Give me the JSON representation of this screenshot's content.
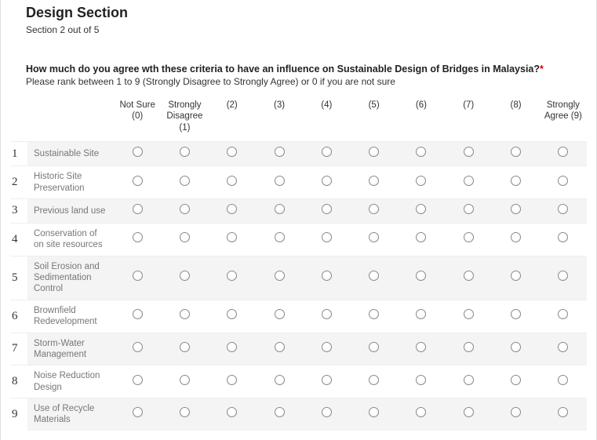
{
  "section": {
    "title": "Design Section",
    "subtitle": "Section 2 out of 5"
  },
  "question": {
    "text": "How much do you agree wth these criteria to have an influence on Sustainable Design of Bridges in Malaysia?",
    "required_mark": "*",
    "instructions": "Please rank between 1 to 9 (Strongly Disagree to Strongly Agree) or 0 if you are not sure"
  },
  "columns": [
    "Not Sure (0)",
    "Strongly Disagree (1)",
    "(2)",
    "(3)",
    "(4)",
    "(5)",
    "(6)",
    "(7)",
    "(8)",
    "Strongly Agree (9)"
  ],
  "rows": [
    {
      "num": "1",
      "label": "Sustainable Site"
    },
    {
      "num": "2",
      "label": "Historic Site Preservation"
    },
    {
      "num": "3",
      "label": "Previous land use"
    },
    {
      "num": "4",
      "label": "Conservation of on site resources"
    },
    {
      "num": "5",
      "label": "Soil Erosion and Sedimentation Control"
    },
    {
      "num": "6",
      "label": "Brownfield Redevelopment"
    },
    {
      "num": "7",
      "label": "Storm-Water Management"
    },
    {
      "num": "8",
      "label": "Noise Reduction Design"
    },
    {
      "num": "9",
      "label": "Use of Recycle Materials"
    }
  ]
}
